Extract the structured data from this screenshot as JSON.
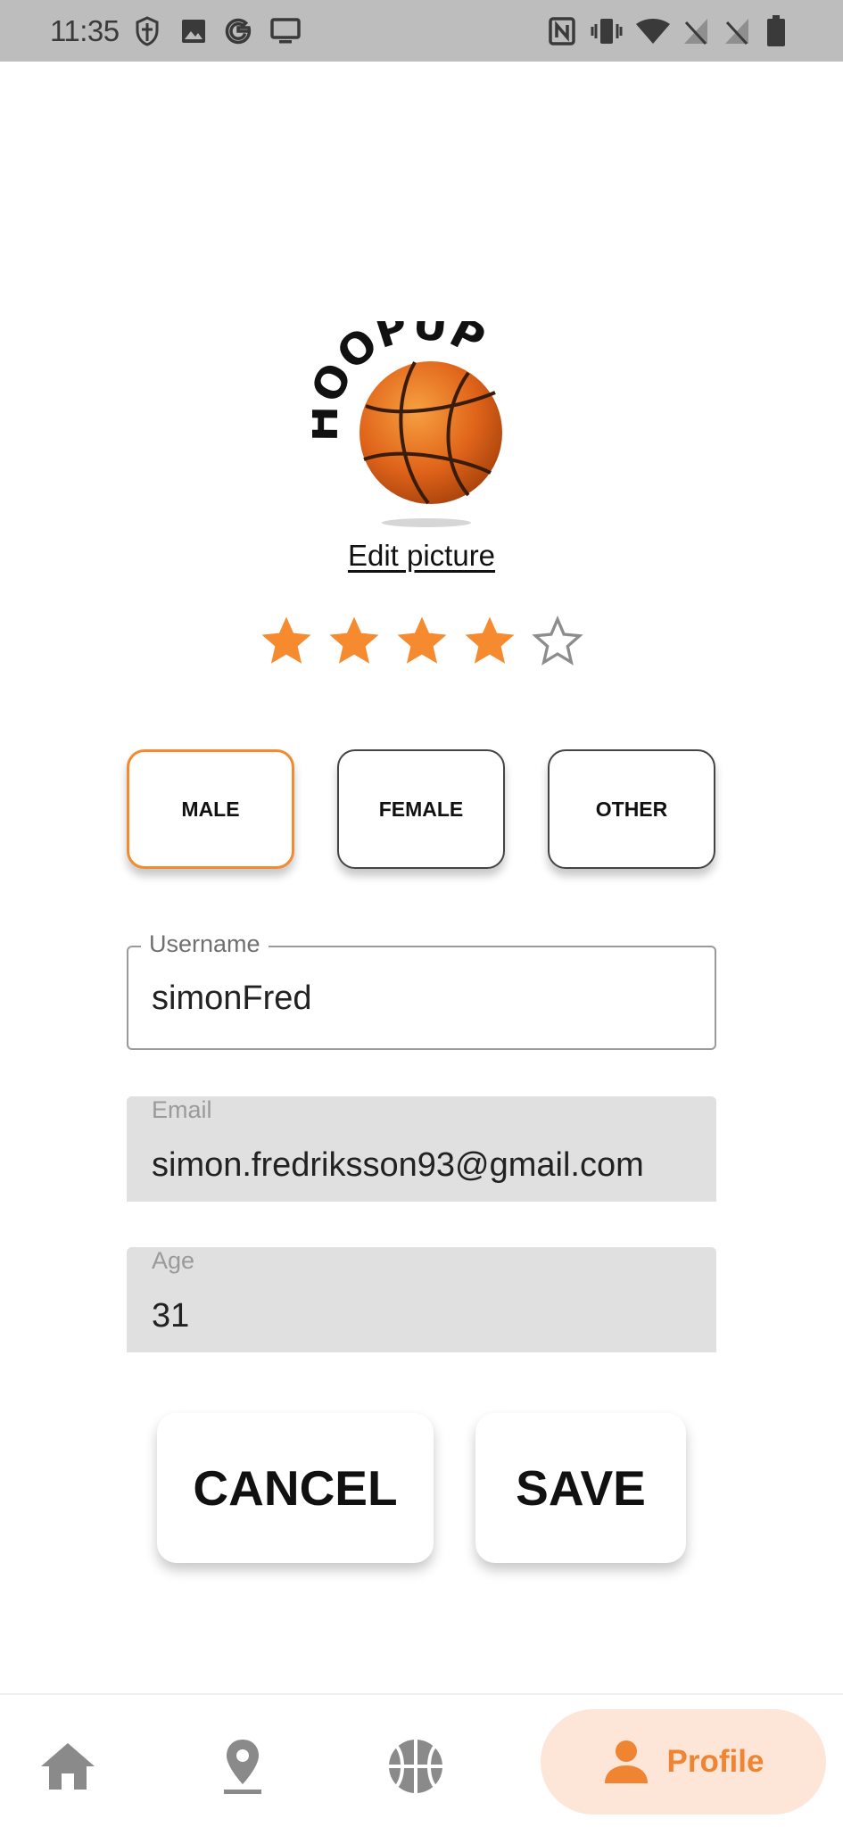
{
  "status_bar": {
    "time": "11:35",
    "left_icons": [
      "shield-icon",
      "gallery-icon",
      "google-icon",
      "cast-icon"
    ],
    "right_icons": [
      "nfc-icon",
      "vibrate-icon",
      "wifi-icon",
      "no-sim-icon",
      "no-sim-icon",
      "battery-icon"
    ]
  },
  "profile": {
    "logo_text": "HOOPUP",
    "edit_picture_label": "Edit picture",
    "rating": 4,
    "rating_max": 5
  },
  "gender": {
    "selected": "MALE",
    "options": [
      "MALE",
      "FEMALE",
      "OTHER"
    ]
  },
  "form": {
    "username": {
      "label": "Username",
      "value": "simonFred"
    },
    "email": {
      "label": "Email",
      "value": "simon.fredriksson93@gmail.com"
    },
    "age": {
      "label": "Age",
      "value": "31"
    }
  },
  "actions": {
    "cancel_label": "CANCEL",
    "save_label": "SAVE"
  },
  "bottom_nav": {
    "items": [
      "home-icon",
      "location-icon",
      "basketball-icon"
    ],
    "active_label": "Profile"
  },
  "colors": {
    "accent": "#f28b2f",
    "status_bar": "#bdbdbd",
    "filled_field": "#e0e0e0",
    "nav_active_bg": "#fde6d8",
    "nav_icon": "#8a8a8a"
  }
}
